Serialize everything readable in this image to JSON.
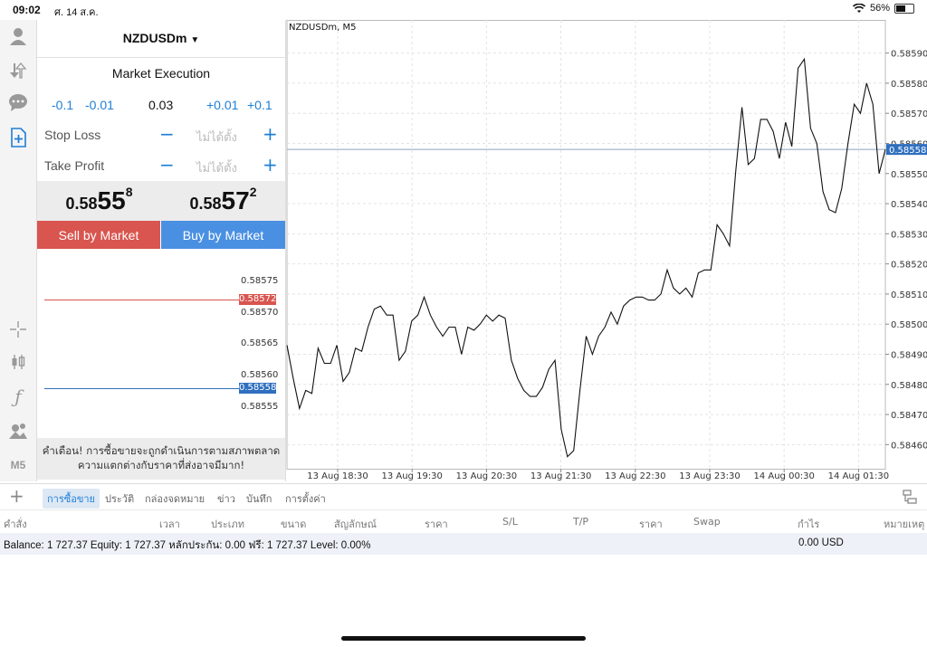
{
  "status": {
    "time": "09:02",
    "date": "ศ. 14 ส.ค.",
    "battery": "56%",
    "battery_level": 0.56
  },
  "toolbar": {
    "bottom_label": "M5"
  },
  "order": {
    "symbol": "NZDUSDm",
    "execution": "Market Execution",
    "volume_steps": [
      "-0.1",
      "-0.01",
      "0.03",
      "+0.01",
      "+0.1"
    ],
    "stop_loss_label": "Stop Loss",
    "take_profit_label": "Take Profit",
    "not_set": "ไม่ได้ตั้ง",
    "minus": "−",
    "plus": "+",
    "sell_price": {
      "prefix": "0.58",
      "big": "55",
      "sup": "8"
    },
    "buy_price": {
      "prefix": "0.58",
      "big": "57",
      "sup": "2"
    },
    "sell_button": "Sell by Market",
    "buy_button": "Buy by Market",
    "mini_levels": [
      "0.58575",
      "0.58570",
      "0.58565",
      "0.58560",
      "0.58555"
    ],
    "ask_tag": "0.58572",
    "bid_tag": "0.58558",
    "warning_line1": "คำเตือน! การซื้อขายจะถูกดำเนินการตามสภาพตลาด",
    "warning_line2": "ความแตกต่างกับราคาที่ส่งอาจมีมาก!"
  },
  "chart_data": {
    "type": "line",
    "title": "NZDUSDm, M5",
    "y_ticks": [
      "0.58590",
      "0.58580",
      "0.58570",
      "0.58560",
      "0.58550",
      "0.58540",
      "0.58530",
      "0.58520",
      "0.58510",
      "0.58500",
      "0.58490",
      "0.58480",
      "0.58470",
      "0.58460"
    ],
    "ylim": [
      0.58452,
      0.58601
    ],
    "x_ticks": [
      "13 Aug 18:30",
      "13 Aug 19:30",
      "13 Aug 20:30",
      "13 Aug 21:30",
      "13 Aug 22:30",
      "13 Aug 23:30",
      "14 Aug 00:30",
      "14 Aug 01:30"
    ],
    "current_price": "0.58558",
    "current_value": 0.58558,
    "values": [
      0.58493,
      0.58482,
      0.58472,
      0.58478,
      0.58477,
      0.58492,
      0.58487,
      0.58487,
      0.58493,
      0.58481,
      0.58484,
      0.58492,
      0.58491,
      0.58499,
      0.58505,
      0.58506,
      0.58503,
      0.58503,
      0.58488,
      0.58491,
      0.58501,
      0.58503,
      0.58509,
      0.58503,
      0.58499,
      0.58496,
      0.58499,
      0.58499,
      0.5849,
      0.58499,
      0.58498,
      0.585,
      0.58503,
      0.58501,
      0.58503,
      0.58502,
      0.58488,
      0.58482,
      0.58478,
      0.58476,
      0.58476,
      0.58479,
      0.58485,
      0.58488,
      0.58465,
      0.58456,
      0.58458,
      0.58478,
      0.58496,
      0.5849,
      0.58496,
      0.58499,
      0.58504,
      0.585,
      0.58506,
      0.58508,
      0.58509,
      0.58509,
      0.58508,
      0.58508,
      0.5851,
      0.58518,
      0.58512,
      0.5851,
      0.58512,
      0.58509,
      0.58517,
      0.58518,
      0.58518,
      0.58533,
      0.5853,
      0.58526,
      0.58551,
      0.58572,
      0.58553,
      0.58555,
      0.58568,
      0.58568,
      0.58564,
      0.58555,
      0.58567,
      0.58559,
      0.58585,
      0.58588,
      0.58565,
      0.5856,
      0.58544,
      0.58538,
      0.58537,
      0.58545,
      0.5856,
      0.58573,
      0.5857,
      0.5858,
      0.58573,
      0.5855,
      0.58558
    ]
  },
  "tabs": [
    "การซื้อขาย",
    "ประวัติ",
    "กล่องจดหมาย",
    "ข่าว",
    "บันทึก",
    "การตั้งค่า"
  ],
  "columns": [
    "คำสั่ง",
    "เวลา",
    "ประเภท",
    "ขนาด",
    "สัญลักษณ์",
    "ราคา",
    "S/L",
    "T/P",
    "ราคา",
    "Swap",
    "กำไร",
    "หมายเหตุ"
  ],
  "balance": {
    "text": "Balance: 1 727.37 Equity: 1 727.37 หลักประกัน: 0.00 ฟรี: 1 727.37 Level: 0.00%",
    "profit": "0.00  USD"
  },
  "colors": {
    "blue": "#1e7fd6",
    "sell": "#d9554f",
    "buy": "#4a90e2",
    "price_tag": "#2f6fbf"
  }
}
